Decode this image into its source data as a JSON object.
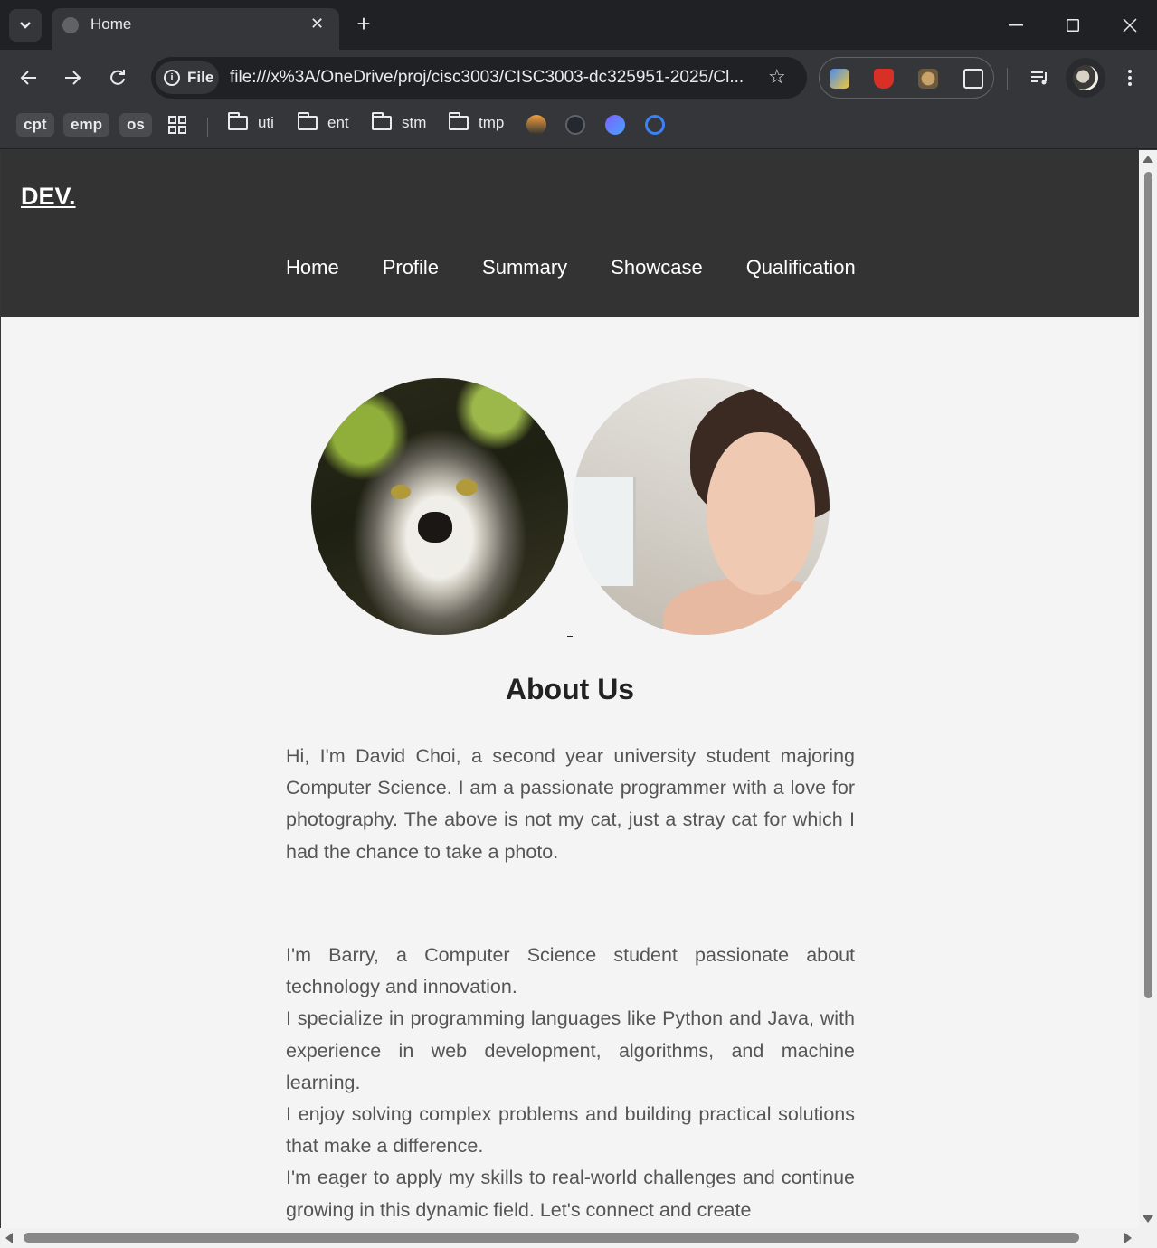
{
  "browser": {
    "tab_title": "Home",
    "url_chip": "File",
    "url": "file:///x%3A/OneDrive/proj/cisc3003/CISC3003-dc325951-2025/Cl...",
    "icons": [
      "tab-search-icon",
      "globe-icon",
      "close-icon",
      "plus-icon",
      "minimize-icon",
      "maximize-icon",
      "back-icon",
      "forward-icon",
      "reload-icon",
      "info-icon",
      "star-icon",
      "extensions-icon",
      "media-icon",
      "more-icon"
    ],
    "bookmarks": {
      "chips": [
        "cpt",
        "emp",
        "os"
      ],
      "folders": [
        "uti",
        "ent",
        "stm",
        "tmp"
      ]
    }
  },
  "site": {
    "logo": "DEV.",
    "nav": [
      "Home",
      "Profile",
      "Summary",
      "Showcase",
      "Qualification"
    ],
    "about_title": "About Us",
    "para1": "Hi, I'm David Choi, a second year university student majoring Computer Science. I am a passionate programmer with a love for photography. The above is not my cat, just a stray cat for which I had the chance to take a photo.",
    "para2": [
      "I'm Barry, a Computer Science student passionate about technology and innovation.",
      "I specialize in programming languages like Python and Java, with experience in web development, algorithms, and machine learning.",
      "I enjoy solving complex problems and building practical solutions that make a difference.",
      "I'm eager to apply my skills to real-world challenges and continue growing in this dynamic field. Let's connect and create"
    ]
  }
}
